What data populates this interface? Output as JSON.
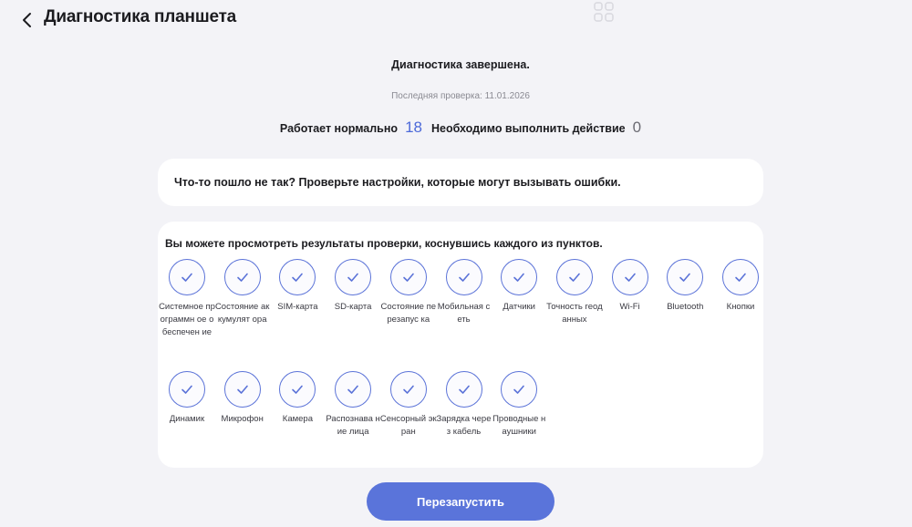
{
  "header": {
    "title": "Диагностика планшета"
  },
  "status": {
    "title": "Диагностика завершена.",
    "last_check": "Последняя проверка: 11.01.2026",
    "ok_label": "Работает нормально",
    "ok_count": "18",
    "action_label": "Необходимо выполнить действие",
    "action_count": "0"
  },
  "warning": {
    "text": "Что-то пошло не так? Проверьте настройки, которые могут вызывать ошибки."
  },
  "results": {
    "hint": "Вы можете просмотреть результаты проверки, коснувшись каждого из пунктов.",
    "items": [
      {
        "label": "Системное программн ое обеспечен ие"
      },
      {
        "label": "Состояние аккумулят ора"
      },
      {
        "label": "SIM-карта"
      },
      {
        "label": "SD-карта"
      },
      {
        "label": "Состояние перезапус ка"
      },
      {
        "label": "Мобильная сеть"
      },
      {
        "label": "Датчики"
      },
      {
        "label": "Точность геоданных"
      },
      {
        "label": "Wi-Fi"
      },
      {
        "label": "Bluetooth"
      },
      {
        "label": "Кнопки"
      },
      {
        "label": "Динамик"
      },
      {
        "label": "Микрофон"
      },
      {
        "label": "Камера"
      },
      {
        "label": "Распознава ние лица"
      },
      {
        "label": "Сенсорный экран"
      },
      {
        "label": "Зарядка через кабель"
      },
      {
        "label": "Проводные наушники"
      }
    ]
  },
  "footer": {
    "restart_label": "Перезапустить"
  },
  "colors": {
    "accent": "#5a74da",
    "ok_count": "#4c69d9",
    "background": "#f3f3f7",
    "card": "#ffffff"
  },
  "icons": {
    "back": "chevron-left-icon",
    "apps": "grid-icon",
    "check": "check-icon"
  }
}
